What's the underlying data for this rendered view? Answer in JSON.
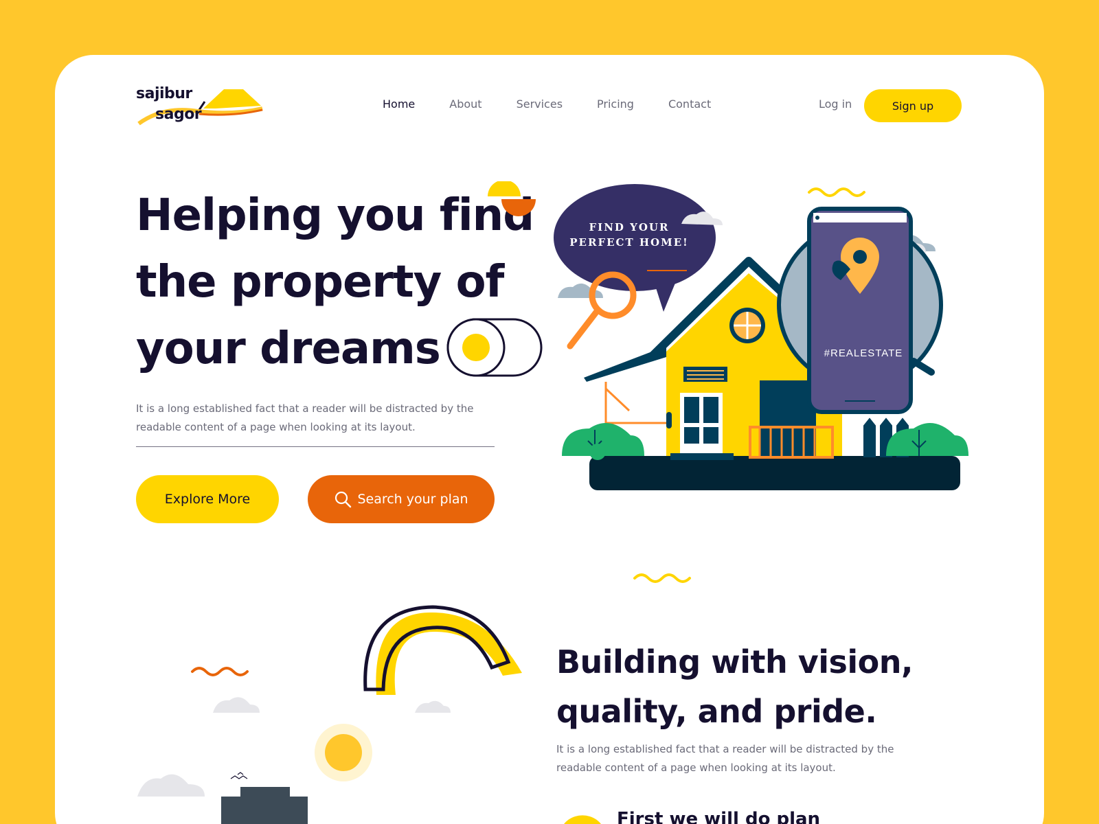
{
  "brand": {
    "line1": "sajibur",
    "line2": "sagor"
  },
  "nav": {
    "items": [
      {
        "label": "Home"
      },
      {
        "label": "About"
      },
      {
        "label": "Services"
      },
      {
        "label": "Pricing"
      },
      {
        "label": "Contact"
      }
    ],
    "login": "Log in",
    "signup": "Sign up"
  },
  "hero": {
    "title": "Helping you find the property of your dreams",
    "description": "It is a long established fact that a reader will be distracted by the readable content of a page when looking at its layout.",
    "explore_label": "Explore More",
    "search_label": "Search your plan",
    "bubble_text": "FIND YOUR PERFECT HOME!",
    "phone_text": "#REALESTATE"
  },
  "section2": {
    "title": "Building with vision, quality, and pride.",
    "description": "It is a long established fact that a reader will be distracted by the readable content of a page when looking at its layout.",
    "step_title": "First we will do plan"
  },
  "colors": {
    "background": "#FFC72C",
    "yellow": "#FFD500",
    "orange": "#E8650A",
    "dark": "#15102f",
    "gray_text": "#6a6a78"
  }
}
